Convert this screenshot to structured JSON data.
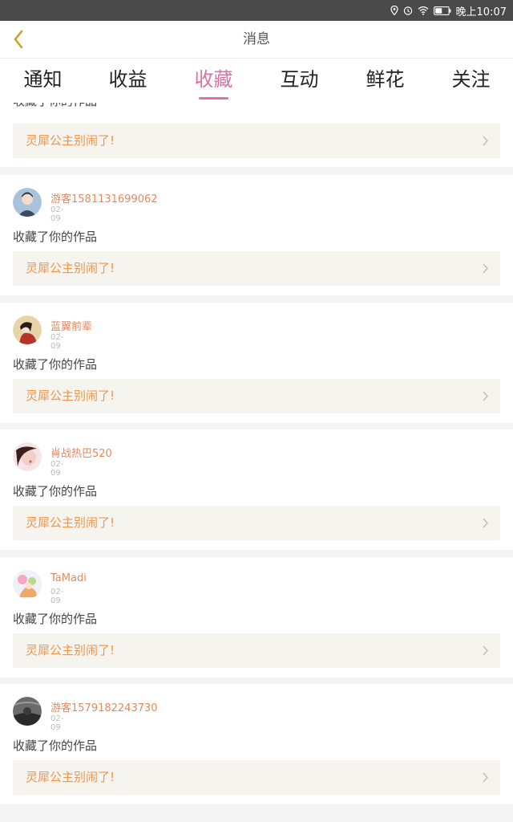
{
  "statusbar": {
    "time": "晚上10:07",
    "icons": [
      "location-icon",
      "alarm-icon",
      "wifi-icon",
      "battery-icon"
    ]
  },
  "header": {
    "title": "消息",
    "back_icon": "chevron-left-icon",
    "back_color": "#c9a227"
  },
  "tabs": [
    {
      "label": "通知",
      "active": false
    },
    {
      "label": "收益",
      "active": false
    },
    {
      "label": "收藏",
      "active": true
    },
    {
      "label": "互动",
      "active": false
    },
    {
      "label": "鲜花",
      "active": false
    },
    {
      "label": "关注",
      "active": false
    }
  ],
  "colors": {
    "accent": "#e06fa3",
    "username": "#e28a60",
    "work_title": "#f0954a",
    "work_bg": "#f5f4ee"
  },
  "feed": {
    "partial_top": {
      "action": "收藏了你的作品",
      "work_title": "灵犀公主别闹了!"
    },
    "items": [
      {
        "user": "游客1581131699062",
        "date": "02-09",
        "action": "收藏了你的作品",
        "work_title": "灵犀公主别闹了!"
      },
      {
        "user": "蓝翼前辈",
        "date": "02-09",
        "action": "收藏了你的作品",
        "work_title": "灵犀公主别闹了!"
      },
      {
        "user": "肖战热巴520",
        "date": "02-09",
        "action": "收藏了你的作品",
        "work_title": "灵犀公主别闹了!"
      },
      {
        "user": "TaMadi",
        "date": "02-09",
        "action": "收藏了你的作品",
        "work_title": "灵犀公主别闹了!"
      },
      {
        "user": "游客1579182243730",
        "date": "02-09",
        "action": "收藏了你的作品",
        "work_title": "灵犀公主别闹了!"
      }
    ]
  }
}
